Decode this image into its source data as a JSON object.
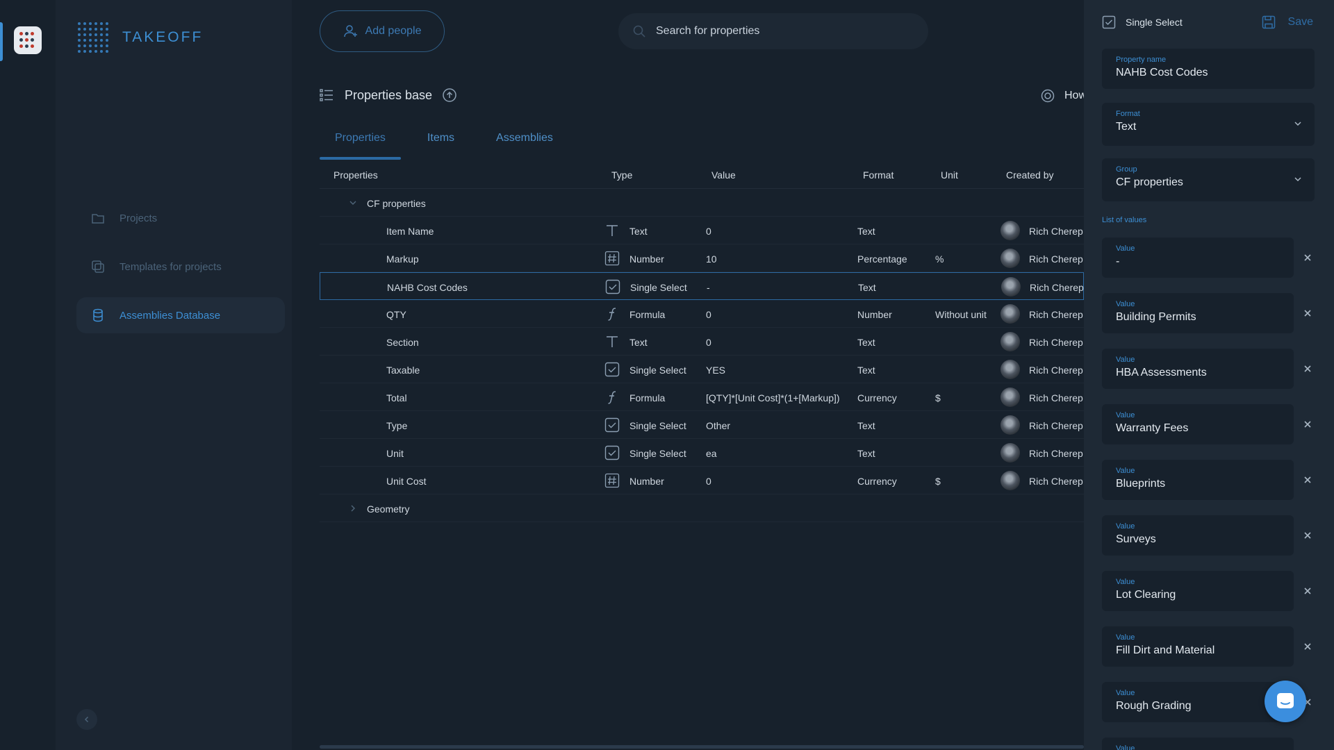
{
  "app": {
    "brand": "TAKEOFF"
  },
  "nav": {
    "items": [
      {
        "label": "Projects",
        "icon": "folder-icon"
      },
      {
        "label": "Templates for projects",
        "icon": "templates-icon"
      },
      {
        "label": "Assemblies Database",
        "icon": "database-icon",
        "active": true
      }
    ]
  },
  "header": {
    "add_people": "Add people",
    "search_placeholder": "Search for properties",
    "page_title": "Properties base",
    "howto": "How"
  },
  "tabs": [
    {
      "label": "Properties",
      "active": true
    },
    {
      "label": "Items"
    },
    {
      "label": "Assemblies"
    }
  ],
  "table": {
    "columns": [
      "Properties",
      "Type",
      "Value",
      "Format",
      "Unit",
      "Created by"
    ],
    "groups": [
      {
        "name": "CF properties",
        "expanded": true,
        "rows": [
          {
            "name": "Item Name",
            "type": "Text",
            "type_icon": "text-type-icon",
            "value": "0",
            "format": "Text",
            "unit": "",
            "created_by": "Rich Cherep"
          },
          {
            "name": "Markup",
            "type": "Number",
            "type_icon": "number-type-icon",
            "value": "10",
            "format": "Percentage",
            "unit": "%",
            "created_by": "Rich Cherep"
          },
          {
            "name": "NAHB Cost Codes",
            "type": "Single Select",
            "type_icon": "single-select-type-icon",
            "value": "-",
            "format": "Text",
            "unit": "",
            "created_by": "Rich Cherep",
            "selected": true
          },
          {
            "name": "QTY",
            "type": "Formula",
            "type_icon": "formula-type-icon",
            "value": "0",
            "format": "Number",
            "unit": "Without unit",
            "created_by": "Rich Cherep"
          },
          {
            "name": "Section",
            "type": "Text",
            "type_icon": "text-type-icon",
            "value": "0",
            "format": "Text",
            "unit": "",
            "created_by": "Rich Cherep"
          },
          {
            "name": "Taxable",
            "type": "Single Select",
            "type_icon": "single-select-type-icon",
            "value": "YES",
            "format": "Text",
            "unit": "",
            "created_by": "Rich Cherep"
          },
          {
            "name": "Total",
            "type": "Formula",
            "type_icon": "formula-type-icon",
            "value": "[QTY]*[Unit Cost]*(1+[Markup])",
            "format": "Currency",
            "unit": "$",
            "created_by": "Rich Cherep"
          },
          {
            "name": "Type",
            "type": "Single Select",
            "type_icon": "single-select-type-icon",
            "value": "Other",
            "format": "Text",
            "unit": "",
            "created_by": "Rich Cherep"
          },
          {
            "name": "Unit",
            "type": "Single Select",
            "type_icon": "single-select-type-icon",
            "value": "ea",
            "format": "Text",
            "unit": "",
            "created_by": "Rich Cherep"
          },
          {
            "name": "Unit Cost",
            "type": "Number",
            "type_icon": "number-type-icon",
            "value": "0",
            "format": "Currency",
            "unit": "$",
            "created_by": "Rich Cherep"
          }
        ]
      },
      {
        "name": "Geometry",
        "expanded": false,
        "rows": []
      }
    ]
  },
  "panel": {
    "type_label": "Single Select",
    "save_label": "Save",
    "property_name": {
      "label": "Property name",
      "value": "NAHB Cost Codes"
    },
    "format": {
      "label": "Format",
      "value": "Text"
    },
    "group": {
      "label": "Group",
      "value": "CF properties"
    },
    "list_title": "List of values",
    "value_label": "Value",
    "values": [
      "-",
      "Building Permits",
      "HBA Assessments",
      "Warranty Fees",
      "Blueprints",
      "Surveys",
      "Lot Clearing",
      "Fill Dirt and Material",
      "Rough Grading",
      ""
    ]
  },
  "colors": {
    "accent": "#3d8fd4",
    "background": "#17212c",
    "panel": "#1e2935"
  }
}
